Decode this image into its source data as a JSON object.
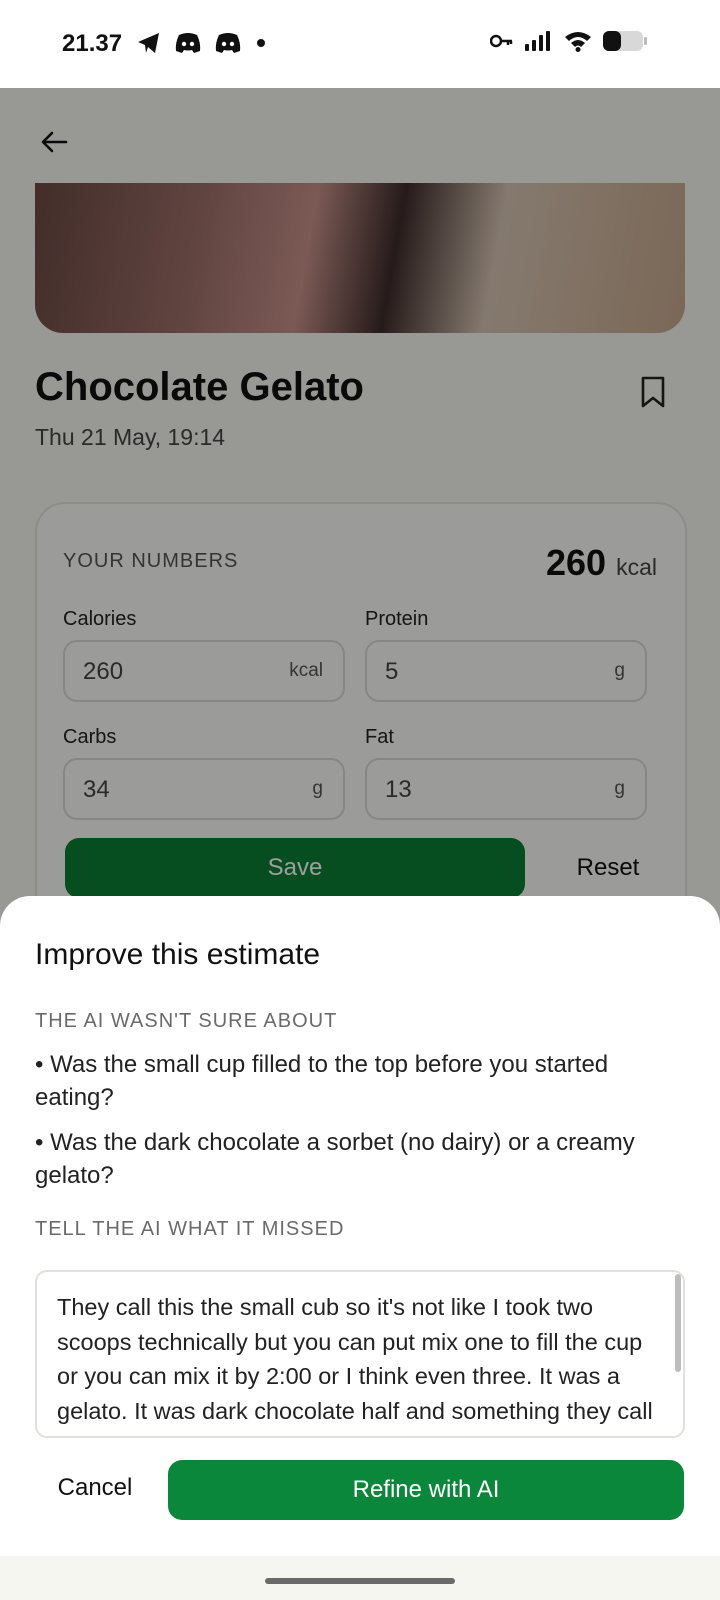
{
  "status_bar": {
    "time": "21.37",
    "icons": [
      "telegram-icon",
      "discord-icon",
      "discord-icon",
      "dot-icon",
      "vpn-key-icon",
      "signal-icon",
      "wifi-icon",
      "battery-icon"
    ]
  },
  "screen": {
    "back_icon": "arrow-left-icon",
    "title": "Chocolate Gelato",
    "date": "Thu 21 May, 19:14",
    "bookmark_icon": "bookmark-icon",
    "numbers": {
      "heading": "YOUR NUMBERS",
      "total_value": "260",
      "total_unit": "kcal",
      "fields": [
        {
          "label": "Calories",
          "value": "260",
          "unit": "kcal"
        },
        {
          "label": "Protein",
          "value": "5",
          "unit": "g"
        },
        {
          "label": "Carbs",
          "value": "34",
          "unit": "g"
        },
        {
          "label": "Fat",
          "value": "13",
          "unit": "g"
        }
      ],
      "save_label": "Save",
      "reset_label": "Reset"
    }
  },
  "sheet": {
    "title": "Improve this estimate",
    "uncertain_label": "THE AI WASN'T SURE ABOUT",
    "questions": [
      "Was the small cup filled to the top before you started eating?",
      "Was the dark chocolate a sorbet (no dairy) or a creamy gelato?"
    ],
    "missed_label": "TELL THE AI WHAT IT MISSED",
    "input_value": "They call this the small cub so it's not like I took two scoops technically but you can put mix one to fill the cup or you can mix it by 2:00 or I think even three. It was a gelato. It was dark chocolate half and something they call it chocolate milk and the picture",
    "cancel_label": "Cancel",
    "refine_label": "Refine with AI"
  },
  "colors": {
    "primary_green": "#0b873b",
    "save_green": "#0b7d35"
  }
}
